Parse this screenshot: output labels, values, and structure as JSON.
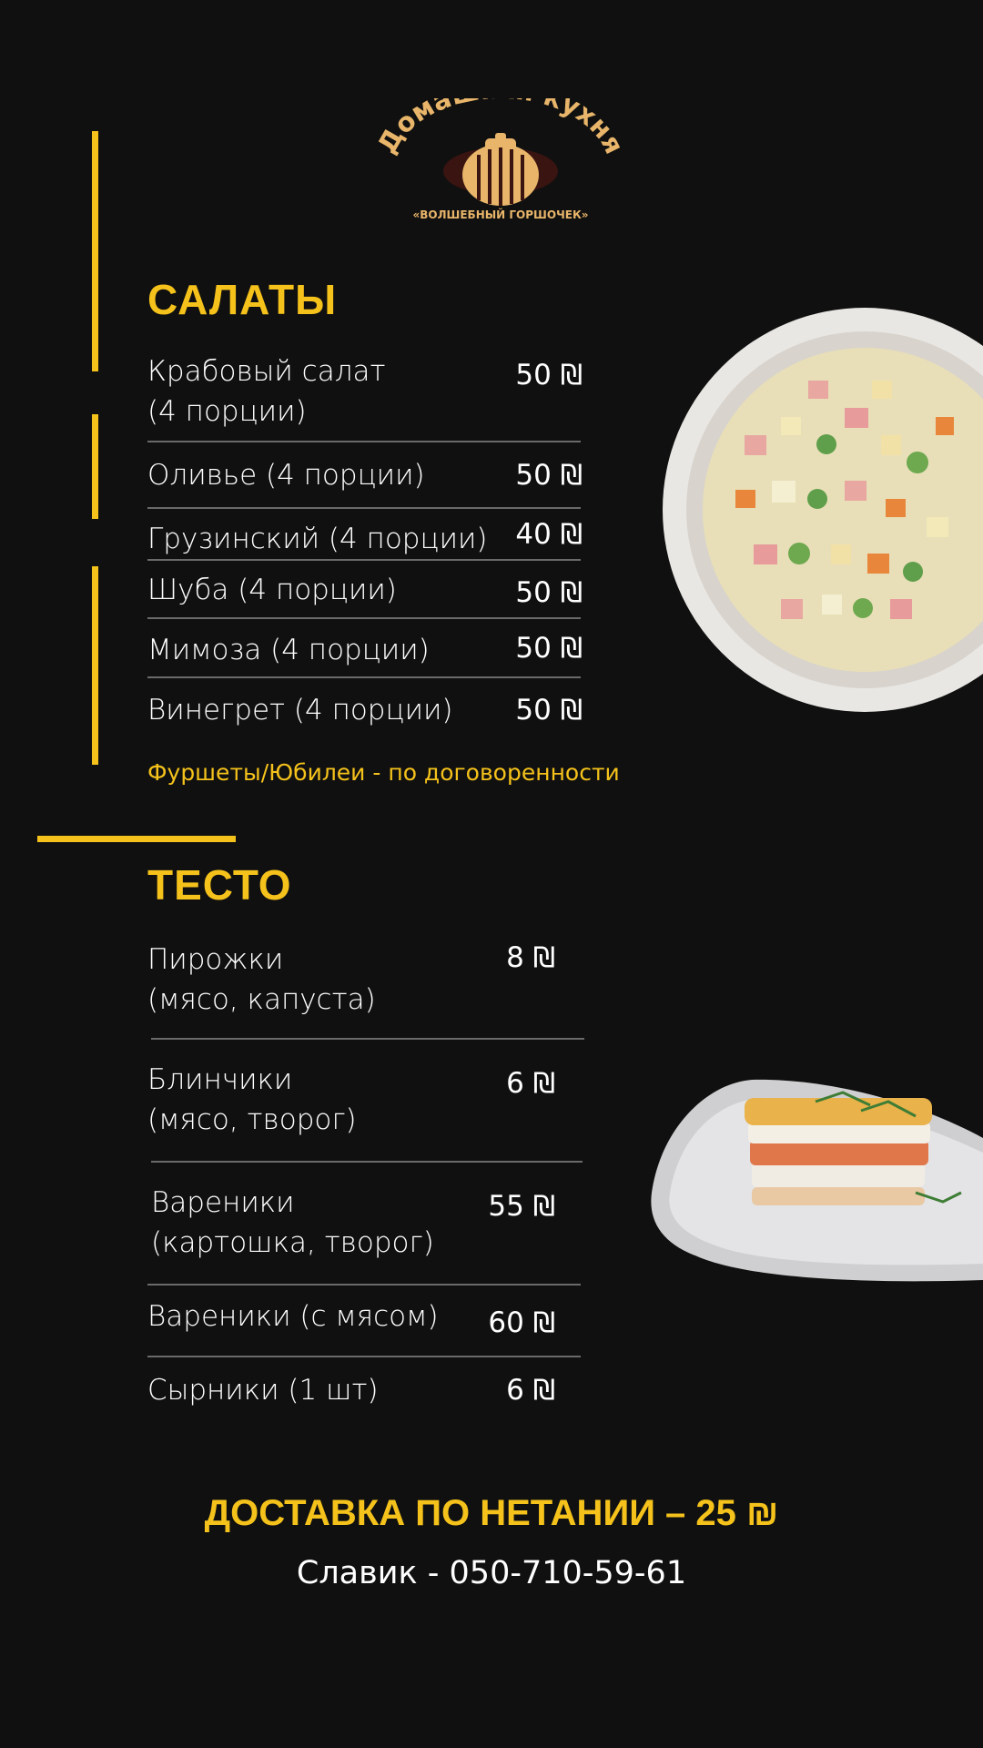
{
  "brand": {
    "name": "Домашняя кухня",
    "subtitle": "«ВОЛШЕБНЫЙ ГОРШОЧЕК»"
  },
  "salads": {
    "title": "САЛАТЫ",
    "items": [
      {
        "name": "Крабовый салат\n(4 порции)",
        "price": "50 ₪"
      },
      {
        "name": "Оливье (4 порции)",
        "price": "50 ₪"
      },
      {
        "name": "Грузинский (4 порции)",
        "price": "40 ₪"
      },
      {
        "name": "Шуба (4 порции)",
        "price": "50 ₪"
      },
      {
        "name": "Мимоза (4 порции)",
        "price": "50 ₪"
      },
      {
        "name": "Винегрет (4 порции)",
        "price": "50 ₪"
      }
    ],
    "note": "Фуршеты/Юбилеи - по договоренности"
  },
  "dough": {
    "title": "ТЕСТО",
    "items": [
      {
        "name": "Пирожки\n(мясо, капуста)",
        "price": "8 ₪"
      },
      {
        "name": "Блинчики\n(мясо, творог)",
        "price": "6 ₪"
      },
      {
        "name": "Вареники\n(картошка, творог)",
        "price": "55 ₪"
      },
      {
        "name": "Вареники (с мясом)",
        "price": "60 ₪"
      },
      {
        "name": "Сырники (1 шт)",
        "price": "6 ₪"
      }
    ]
  },
  "delivery": "ДОСТАВКА ПО НЕТАНИИ – 25 ₪",
  "contact": "Славик - 050-710-59-61",
  "colors": {
    "accent": "#f5c21b",
    "background": "#101010",
    "text": "#ffffff",
    "rule": "#6a6a6a"
  }
}
